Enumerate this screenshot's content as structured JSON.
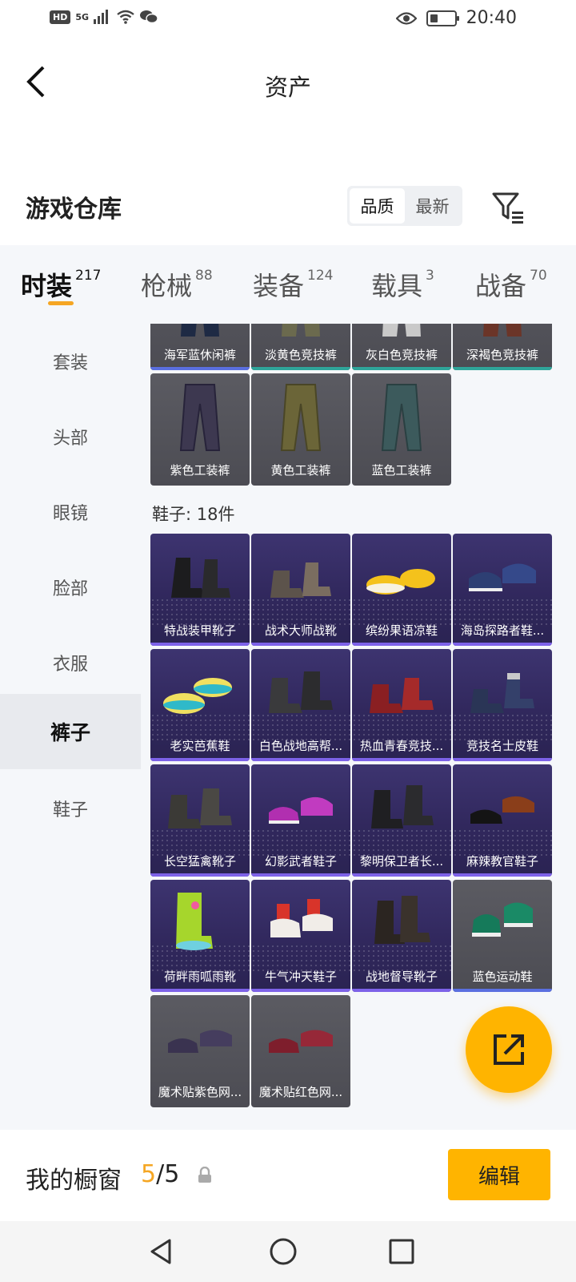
{
  "status_bar": {
    "hd_label": "HD",
    "network_label": "5G",
    "time": "20:40",
    "battery_percent": 30
  },
  "header": {
    "title": "资产"
  },
  "warehouse": {
    "title": "游戏仓库",
    "sort_options": [
      "品质",
      "最新"
    ],
    "active_sort": "品质"
  },
  "tabs": [
    {
      "label": "时装",
      "count": "217",
      "active": true
    },
    {
      "label": "枪械",
      "count": "88"
    },
    {
      "label": "装备",
      "count": "124"
    },
    {
      "label": "载具",
      "count": "3"
    },
    {
      "label": "战备",
      "count": "70"
    }
  ],
  "sidebar": {
    "items": [
      "套装",
      "头部",
      "眼镜",
      "脸部",
      "衣服",
      "裤子",
      "鞋子"
    ],
    "active": "裤子"
  },
  "pants": {
    "row1": [
      "海军蓝休闲裤",
      "淡黄色竞技裤",
      "灰白色竞技裤",
      "深褐色竞技裤"
    ],
    "row2": [
      "紫色工装裤",
      "黄色工装裤",
      "蓝色工装裤"
    ]
  },
  "shoes": {
    "section_title": "鞋子: 18件",
    "items": [
      "特战装甲靴子",
      "战术大师战靴",
      "缤纷果语凉鞋",
      "海岛探路者鞋...",
      "老实芭蕉鞋",
      "白色战地高帮...",
      "热血青春竞技...",
      "竞技名士皮鞋",
      "长空猛禽靴子",
      "幻影武者鞋子",
      "黎明保卫者长...",
      "麻辣教官鞋子",
      "荷畔雨呱雨靴",
      "牛气冲天鞋子",
      "战地督导靴子",
      "蓝色运动鞋",
      "魔术贴紫色网...",
      "魔术贴红色网..."
    ]
  },
  "showcase": {
    "title": "我的橱窗",
    "current": "5",
    "total": "/5",
    "edit_label": "编辑"
  },
  "colors": {
    "accent": "#ffb400",
    "tab_underline": "#f5a623",
    "purple_card": "#342b63",
    "grey_card": "#54545b"
  }
}
